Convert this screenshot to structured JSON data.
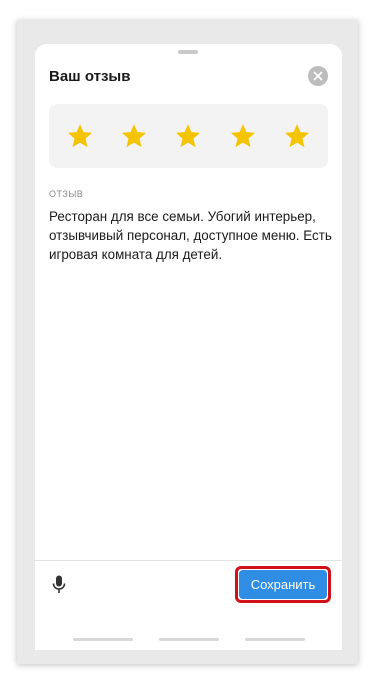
{
  "sheet": {
    "title": "Ваш отзыв",
    "close_icon": "close-icon"
  },
  "rating": {
    "value": 5,
    "max": 5,
    "star_color": "#f5c400"
  },
  "review": {
    "label": "ОТЗЫВ",
    "text": "Ресторан для все семьи. Убогий интерьер, отзывчивый персонал, доступное меню. Есть игровая комната для детей."
  },
  "footer": {
    "mic_icon": "microphone-icon",
    "save_label": "Сохранить",
    "save_color": "#2f8de4",
    "highlight_color": "#d0101b"
  }
}
